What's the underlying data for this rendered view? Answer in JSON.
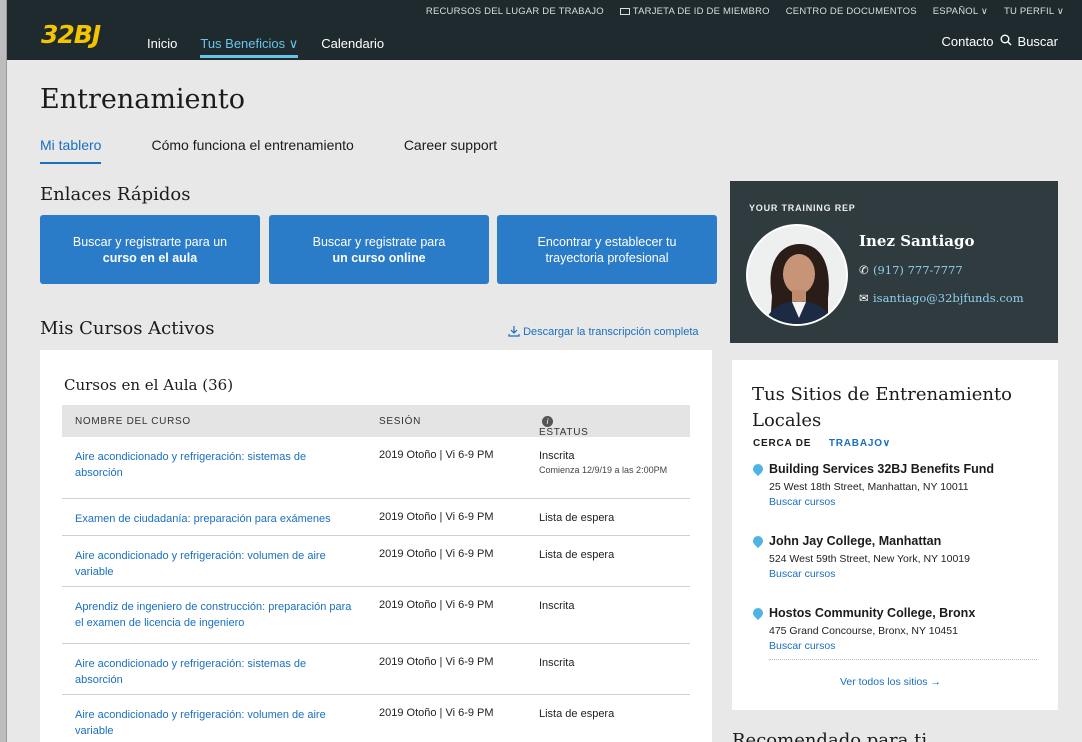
{
  "header": {
    "logo": "32BJ",
    "utility": [
      "RECURSOS DEL LUGAR DE TRABAJO",
      "TARJETA DE ID DE MIEMBRO",
      "CENTRO DE DOCUMENTOS",
      "ESPAÑOL ∨",
      "TU PERFIL ∨"
    ],
    "nav": [
      "Inicio",
      "Tus Beneficios ∨",
      "Calendario"
    ],
    "contact": "Contacto",
    "search": "Buscar"
  },
  "page": {
    "title": "Entrenamiento",
    "tabs": [
      "Mi tablero",
      "Cómo funciona el entrenamiento",
      "Career support"
    ]
  },
  "quick_links": {
    "heading": "Enlaces Rápidos",
    "buttons": [
      {
        "line1": "Buscar y registrarte para un",
        "line2": "curso en el aula"
      },
      {
        "line1": "Buscar y registrate para",
        "line2": "un curso online"
      },
      {
        "line1": "Encontrar y establecer tu",
        "line2": "trayectoria profesional"
      }
    ]
  },
  "courses": {
    "heading": "Mis Cursos Activos",
    "download": "Descargar la transcripción completa",
    "panel_title": "Cursos en el Aula (36)",
    "columns": [
      "NOMBRE DEL CURSO",
      "SESIÓN",
      "ESTATUS"
    ],
    "rows": [
      {
        "name": "Aire acondicionado y refrigeración: sistemas de absorción",
        "session": "2019 Otoño | Vi 6-9 PM",
        "status": "Inscrita",
        "note": "Comienza 12/9/19 a las 2:00PM"
      },
      {
        "name": "Examen de ciudadanía: preparación para exámenes",
        "session": "2019 Otoño | Vi 6-9 PM",
        "status": "Lista de espera",
        "note": ""
      },
      {
        "name": "Aire acondicionado y refrigeración: volumen de aire variable",
        "session": "2019 Otoño | Vi 6-9 PM",
        "status": "Lista de espera",
        "note": ""
      },
      {
        "name": "Aprendiz de ingeniero de construcción: preparación para el examen de licencia de ingeniero",
        "session": "2019 Otoño | Vi 6-9 PM",
        "status": "Inscrita",
        "note": ""
      },
      {
        "name": "Aire acondicionado y refrigeración: sistemas de absorción",
        "session": "2019 Otoño | Vi 6-9 PM",
        "status": "Inscrita",
        "note": ""
      },
      {
        "name": "Aire acondicionado y refrigeración: volumen de aire variable",
        "session": "2019 Otoño | Vi 6-9 PM",
        "status": "Lista de espera",
        "note": ""
      }
    ]
  },
  "training_rep": {
    "label": "YOUR TRAINING REP",
    "name": "Inez Santiago",
    "phone": "(917) 777-7777",
    "email": "isantiago@32bjfunds.com"
  },
  "sites": {
    "title": "Tus Sitios de Entrenamiento Locales",
    "near_label": "CERCA DE",
    "near_value": "TRABAJO∨",
    "items": [
      {
        "name": "Building Services 32BJ Benefits Fund",
        "address": "25 West 18th Street, Manhattan, NY 10011",
        "link": "Buscar cursos"
      },
      {
        "name": "John Jay College, Manhattan",
        "address": "524 West 59th Street, New York, NY 10019",
        "link": "Buscar cursos"
      },
      {
        "name": "Hostos Community College, Bronx",
        "address": "475 Grand Concourse, Bronx, NY 10451",
        "link": "Buscar cursos"
      }
    ],
    "view_all": "Ver todos los sitios →"
  },
  "recommended": {
    "heading": "Recomendado para ti"
  },
  "colors": {
    "nav_bg": "#1f2a2e",
    "logo": "#f5c400",
    "accent": "#1a6fbf",
    "button": "#2b7cc8",
    "rep_bg": "#2f3b3f"
  }
}
